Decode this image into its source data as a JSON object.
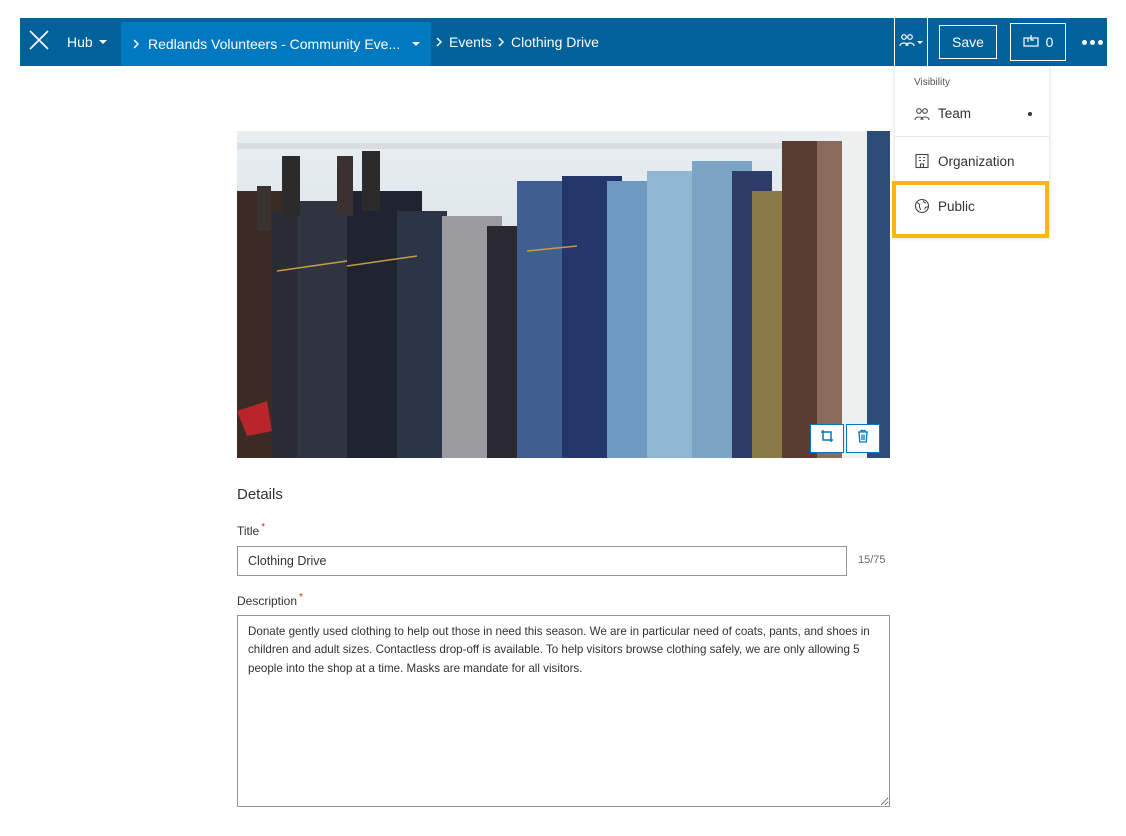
{
  "topbar": {
    "hub_label": "Hub",
    "site_crumb": "Redlands Volunteers - Community Eve...",
    "events_crumb": "Events",
    "page_crumb": "Clothing Drive",
    "save_label": "Save",
    "notifications_count": "0",
    "bar_color": "#00619b",
    "active_crumb_color": "#0079c1"
  },
  "visibility_menu": {
    "heading": "Visibility",
    "items": [
      {
        "label": "Team",
        "icon": "team-icon",
        "selected": true
      },
      {
        "label": "Organization",
        "icon": "organization-icon",
        "selected": false
      },
      {
        "label": "Public",
        "icon": "globe-icon",
        "selected": false
      }
    ],
    "highlight_color": "#f6b80c"
  },
  "image_tools": [
    {
      "icon": "crop-icon"
    },
    {
      "icon": "trash-icon"
    }
  ],
  "details": {
    "section_title": "Details",
    "title_label": "Title",
    "required_mark": "*",
    "title_value": "Clothing Drive",
    "title_counter": "15/75",
    "description_label": "Description",
    "description_value": "Donate gently used clothing to help out those in need this season. We are in particular need of coats, pants, and shoes in children and adult sizes. Contactless drop-off is available. To help visitors browse clothing safely, we are only allowing 5 people into the shop at a time. Masks are mandate for all visitors."
  }
}
